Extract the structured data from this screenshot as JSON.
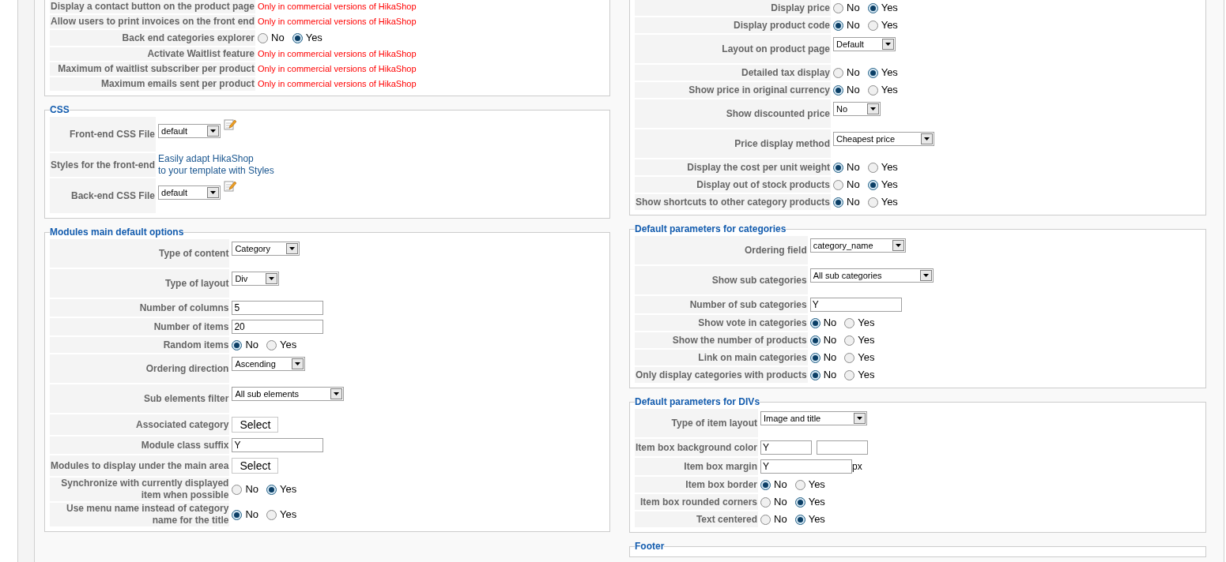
{
  "columns": [
    {
      "sections": [
        {
          "rows": [
            {
              "kind": "notice",
              "label": "Display a contact button on the product page",
              "text": "Only in commercial versions of HikaShop"
            },
            {
              "kind": "notice",
              "label": "Allow users to print invoices on the front end",
              "text": "Only in commercial versions of HikaShop"
            },
            {
              "kind": "radio",
              "label": "Back end categories explorer",
              "options": [
                {
                  "label": "No",
                  "selected": false
                },
                {
                  "label": "Yes",
                  "selected": true
                }
              ]
            },
            {
              "kind": "notice",
              "label": "Activate Waitlist feature",
              "text": "Only in commercial versions of HikaShop"
            },
            {
              "kind": "notice",
              "label": "Maximum of waitlist subscriber per product",
              "text": "Only in commercial versions of HikaShop"
            },
            {
              "kind": "notice",
              "label": "Maximum emails sent per product",
              "text": "Only in commercial versions of HikaShop"
            }
          ]
        },
        {
          "legend": "CSS",
          "rows": [
            {
              "kind": "css_file",
              "label": "Front-end CSS File",
              "value": "default"
            },
            {
              "kind": "link",
              "label": "Styles for the front-end",
              "lines": [
                "Easily adapt HikaShop",
                "to your template with Styles"
              ]
            },
            {
              "kind": "css_file",
              "label": "Back-end CSS File",
              "value": "default"
            }
          ]
        },
        {
          "legend": "Modules main default options",
          "rows": [
            {
              "kind": "select",
              "label": "Type of content",
              "value": "Category"
            },
            {
              "kind": "select",
              "label": "Type of layout",
              "value": "Div"
            },
            {
              "kind": "text",
              "label": "Number of columns",
              "value": "5"
            },
            {
              "kind": "text",
              "label": "Number of items",
              "value": "20"
            },
            {
              "kind": "radio",
              "label": "Random items",
              "options": [
                {
                  "label": "No",
                  "selected": true
                },
                {
                  "label": "Yes",
                  "selected": false
                }
              ]
            },
            {
              "kind": "select",
              "label": "Ordering direction",
              "value": "Ascending"
            },
            {
              "kind": "select",
              "label": "Sub elements filter",
              "value": "All sub elements"
            },
            {
              "kind": "button",
              "label": "Associated category",
              "text": "Select"
            },
            {
              "kind": "text",
              "label": "Module class suffix",
              "value": "Y"
            },
            {
              "kind": "button",
              "label": "Modules to display under the main area",
              "text": "Select"
            },
            {
              "kind": "radio",
              "label": "Synchronize with currently displayed item when possible",
              "options": [
                {
                  "label": "No",
                  "selected": false
                },
                {
                  "label": "Yes",
                  "selected": true
                }
              ]
            },
            {
              "kind": "radio",
              "label": "Use menu name instead of category name for the title",
              "options": [
                {
                  "label": "No",
                  "selected": true
                },
                {
                  "label": "Yes",
                  "selected": false
                }
              ]
            }
          ]
        }
      ]
    },
    {
      "sections": [
        {
          "rows": [
            {
              "kind": "radio",
              "label": "Display price",
              "options": [
                {
                  "label": "No",
                  "selected": false
                },
                {
                  "label": "Yes",
                  "selected": true
                }
              ]
            },
            {
              "kind": "radio",
              "label": "Display product code",
              "options": [
                {
                  "label": "No",
                  "selected": true
                },
                {
                  "label": "Yes",
                  "selected": false
                }
              ]
            },
            {
              "kind": "select",
              "label": "Layout on product page",
              "value": "Default"
            },
            {
              "kind": "radio",
              "label": "Detailed tax display",
              "options": [
                {
                  "label": "No",
                  "selected": false
                },
                {
                  "label": "Yes",
                  "selected": true
                }
              ]
            },
            {
              "kind": "radio",
              "label": "Show price in original currency",
              "options": [
                {
                  "label": "No",
                  "selected": true
                },
                {
                  "label": "Yes",
                  "selected": false
                }
              ]
            },
            {
              "kind": "select",
              "label": "Show discounted price",
              "value": "No"
            },
            {
              "kind": "select",
              "label": "Price display method",
              "value": "Cheapest price"
            },
            {
              "kind": "radio",
              "label": "Display the cost per unit weight",
              "options": [
                {
                  "label": "No",
                  "selected": true
                },
                {
                  "label": "Yes",
                  "selected": false
                }
              ]
            },
            {
              "kind": "radio",
              "label": "Display out of stock products",
              "options": [
                {
                  "label": "No",
                  "selected": false
                },
                {
                  "label": "Yes",
                  "selected": true
                }
              ]
            },
            {
              "kind": "radio",
              "label": "Show shortcuts to other category products",
              "options": [
                {
                  "label": "No",
                  "selected": true
                },
                {
                  "label": "Yes",
                  "selected": false
                }
              ]
            }
          ]
        },
        {
          "legend": "Default parameters for categories",
          "rows": [
            {
              "kind": "select",
              "label": "Ordering field",
              "value": "category_name"
            },
            {
              "kind": "select",
              "label": "Show sub categories",
              "value": "All sub categories"
            },
            {
              "kind": "text",
              "label": "Number of sub categories",
              "value": "Y"
            },
            {
              "kind": "radio",
              "label": "Show vote in categories",
              "options": [
                {
                  "label": "No",
                  "selected": true
                },
                {
                  "label": "Yes",
                  "selected": false
                }
              ]
            },
            {
              "kind": "radio",
              "label": "Show the number of products",
              "options": [
                {
                  "label": "No",
                  "selected": true
                },
                {
                  "label": "Yes",
                  "selected": false
                }
              ]
            },
            {
              "kind": "radio",
              "label": "Link on main categories",
              "options": [
                {
                  "label": "No",
                  "selected": true
                },
                {
                  "label": "Yes",
                  "selected": false
                }
              ]
            },
            {
              "kind": "radio",
              "label": "Only display categories with products",
              "options": [
                {
                  "label": "No",
                  "selected": true
                },
                {
                  "label": "Yes",
                  "selected": false
                }
              ]
            }
          ]
        },
        {
          "legend": "Default parameters for DIVs",
          "rows": [
            {
              "kind": "select",
              "label": "Type of item layout",
              "value": "Image and title"
            },
            {
              "kind": "color_pair",
              "label": "Item box background color",
              "value": "Y"
            },
            {
              "kind": "text_unit",
              "label": "Item box margin",
              "value": "Y",
              "unit": "px"
            },
            {
              "kind": "radio",
              "label": "Item box border",
              "options": [
                {
                  "label": "No",
                  "selected": true
                },
                {
                  "label": "Yes",
                  "selected": false
                }
              ]
            },
            {
              "kind": "radio",
              "label": "Item box rounded corners",
              "options": [
                {
                  "label": "No",
                  "selected": false
                },
                {
                  "label": "Yes",
                  "selected": true
                }
              ]
            },
            {
              "kind": "radio",
              "label": "Text centered",
              "options": [
                {
                  "label": "No",
                  "selected": false
                },
                {
                  "label": "Yes",
                  "selected": true
                }
              ]
            }
          ]
        },
        {
          "legend": "Footer"
        }
      ]
    }
  ]
}
